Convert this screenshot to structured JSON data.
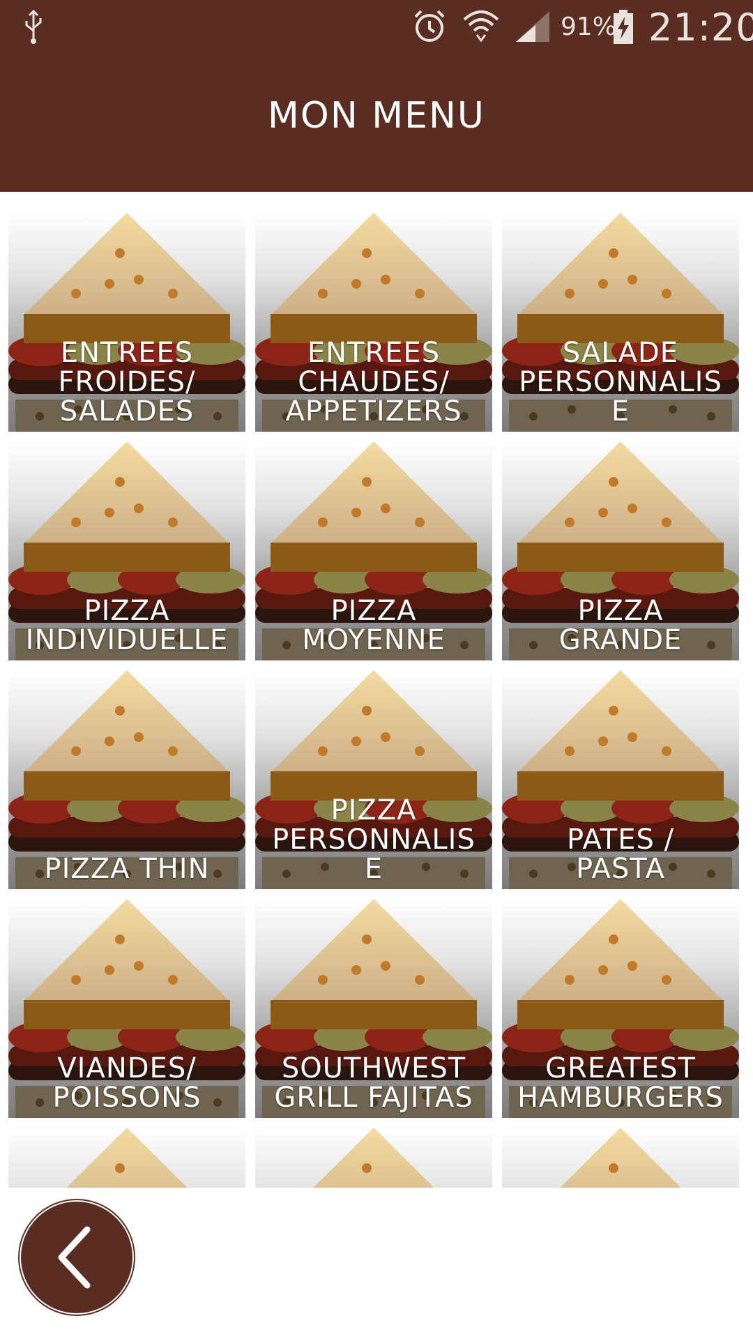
{
  "status_bar": {
    "battery_percent": "91%",
    "time": "21:20",
    "icons": [
      "usb-icon",
      "alarm-icon",
      "wifi-icon",
      "signal-icon",
      "battery-charging-icon"
    ]
  },
  "header": {
    "title": "MON MENU",
    "background_color": "#5a2d22"
  },
  "menu": {
    "items": [
      {
        "label": "ENTREES\nFROIDES/\nSALADES"
      },
      {
        "label": "ENTREES\nCHAUDES/\nAPPETIZERS"
      },
      {
        "label": "SALADE\nPERSONNALIS\nE"
      },
      {
        "label": "PIZZA\nINDIVIDUELLE"
      },
      {
        "label": "PIZZA\nMOYENNE"
      },
      {
        "label": "PIZZA\nGRANDE"
      },
      {
        "label": "PIZZA THIN"
      },
      {
        "label": "PIZZA\nPERSONNALIS\nE"
      },
      {
        "label": "PATES /\nPASTA"
      },
      {
        "label": "VIANDES/\nPOISSONS"
      },
      {
        "label": "SOUTHWEST\nGRILL FAJITAS"
      },
      {
        "label": "GREATEST\nHAMBURGERS"
      },
      {
        "label": ""
      },
      {
        "label": ""
      },
      {
        "label": ""
      }
    ]
  },
  "back_button": {
    "icon": "chevron-left-icon",
    "color": "#5a2d22"
  }
}
